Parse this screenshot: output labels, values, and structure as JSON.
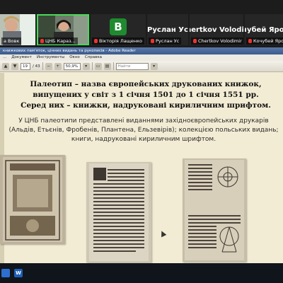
{
  "participants": [
    {
      "name": "а Вовк",
      "kind": "video"
    },
    {
      "name": "ЦНБ Караз...",
      "kind": "video",
      "active": true
    },
    {
      "name": "Вікторія Лащенко",
      "kind": "avatar",
      "initial": "B"
    },
    {
      "name": "Руслан Ус",
      "kind": "text",
      "big": "Руслан Ус"
    },
    {
      "name": "Chertkov Volodimir",
      "kind": "text",
      "big": "Chertkov Volodi..."
    },
    {
      "name": "Кочубей Ярос...",
      "kind": "text",
      "big": "Кочубей Ярос..."
    }
  ],
  "reader": {
    "title": "книжкових пам'яток, цінних видань та рукописів - Adobe Reader",
    "menu": [
      "...",
      "Документ",
      "Инструменты",
      "Окно",
      "Справка"
    ],
    "page_current": "19",
    "page_total": "/ 43",
    "zoom": "50,9%",
    "search_placeholder": "Найти"
  },
  "slide": {
    "headline": [
      "Палеотип – назва європейських друкованих книжок,",
      "випущених у світ з 1 січня 1501 до 1 січня 1551 рр.",
      "Серед них – книжки, надруковані кириличним шрифтом."
    ],
    "body": [
      "У ЦНБ палеотипи представлені виданнями західноєвропейських друкарів",
      "(Альдів, Етьєнів, Фробенів, Плантена, Ельзевірів); колекцією польських видань;",
      "книги, надруковані кириличним шрифтом."
    ]
  },
  "taskbar": {
    "word_letter": "W"
  }
}
